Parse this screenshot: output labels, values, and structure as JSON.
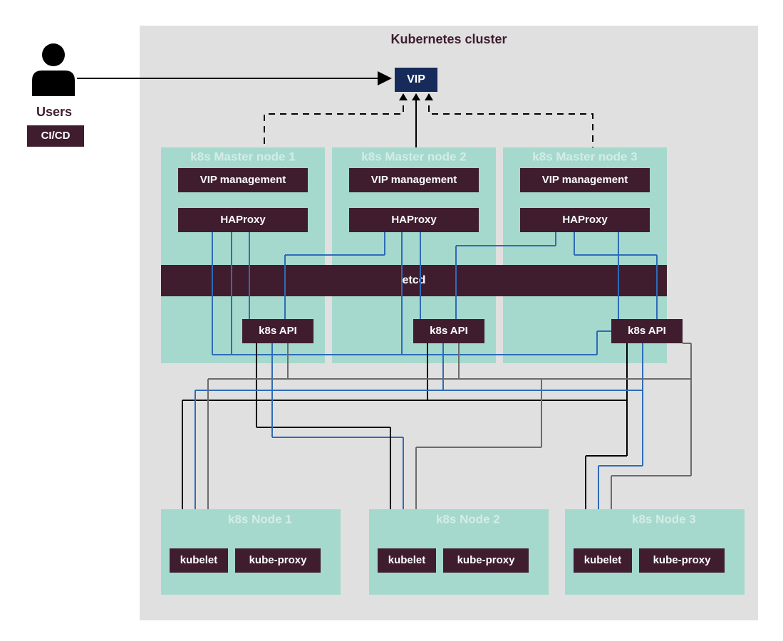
{
  "title": "Kubernetes cluster",
  "users": {
    "label": "Users",
    "cicd": "CI/CD"
  },
  "vip": "VIP",
  "masters": [
    {
      "title": "k8s Master node 1",
      "vip_mgmt": "VIP management",
      "haproxy": "HAProxy",
      "api": "k8s API"
    },
    {
      "title": "k8s Master node 2",
      "vip_mgmt": "VIP management",
      "haproxy": "HAProxy",
      "api": "k8s API"
    },
    {
      "title": "k8s Master node 3",
      "vip_mgmt": "VIP management",
      "haproxy": "HAProxy",
      "api": "k8s API"
    }
  ],
  "etcd": "etcd",
  "workers": [
    {
      "title": "k8s Node 1",
      "kubelet": "kubelet",
      "kubeproxy": "kube-proxy"
    },
    {
      "title": "k8s Node 2",
      "kubelet": "kubelet",
      "kubeproxy": "kube-proxy"
    },
    {
      "title": "k8s Node 3",
      "kubelet": "kubelet",
      "kubeproxy": "kube-proxy"
    }
  ]
}
